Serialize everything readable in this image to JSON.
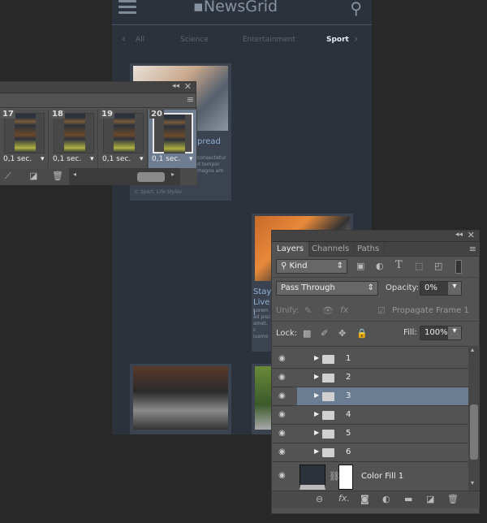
{
  "app": {
    "logo_prefix": "News",
    "logo_suffix": "Grid"
  },
  "nav": {
    "items": [
      "All",
      "Science",
      "Entertainment",
      "Sport"
    ],
    "active": "Sport"
  },
  "cards": [
    {
      "title": "pread",
      "text": "consectetur d tempor magna am",
      "tag": "Sport, Life Styles"
    },
    {
      "title": "Stay Live l",
      "text": "Lorem ad pisc amet, c iusmo",
      "tag": "Sport, Life Styles"
    }
  ],
  "timeline": {
    "frames": [
      {
        "num": "17",
        "delay": "0,1 sec."
      },
      {
        "num": "18",
        "delay": "0,1 sec."
      },
      {
        "num": "19",
        "delay": "0,1 sec."
      },
      {
        "num": "20",
        "delay": "0,1 sec.",
        "selected": true
      }
    ]
  },
  "layers": {
    "tabs": [
      "Layers",
      "Channels",
      "Paths"
    ],
    "filter": "Kind",
    "blend_mode": "Pass Through",
    "opacity_label": "Opacity:",
    "opacity": "0%",
    "unify_label": "Unify:",
    "propagate": "Propagate Frame 1",
    "lock_label": "Lock:",
    "fill_label": "Fill:",
    "fill": "100%",
    "items": [
      {
        "name": "1"
      },
      {
        "name": "2"
      },
      {
        "name": "3",
        "selected": true
      },
      {
        "name": "4"
      },
      {
        "name": "5"
      },
      {
        "name": "6"
      }
    ],
    "fill_layer": "Color Fill 1",
    "selected_color": "#6a7d93"
  }
}
